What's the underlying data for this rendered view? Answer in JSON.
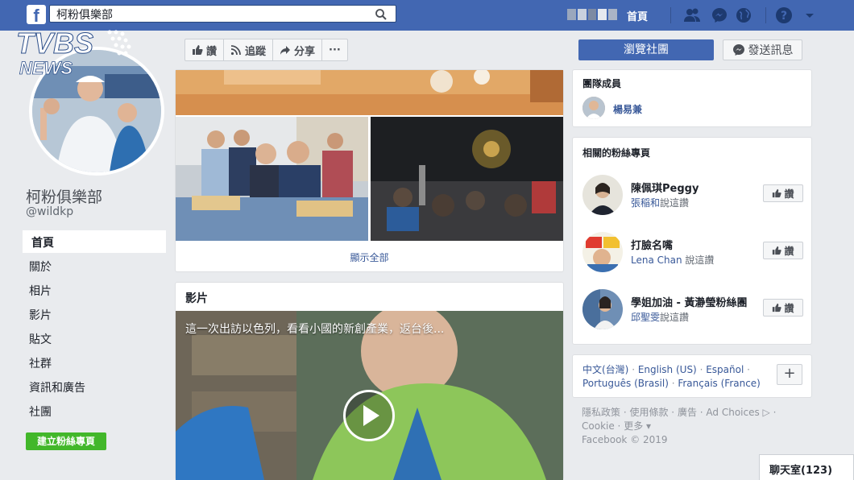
{
  "topbar": {
    "search_value": "柯粉俱樂部",
    "home_label": "首頁"
  },
  "watermark": {
    "brand": "TVBS NEWS"
  },
  "page": {
    "name": "柯粉俱樂部",
    "handle": "@wildkp"
  },
  "left_nav": {
    "items": [
      "首頁",
      "關於",
      "相片",
      "影片",
      "貼文",
      "社群",
      "資訊和廣告",
      "社團"
    ],
    "create_label": "建立粉絲專頁"
  },
  "actions": {
    "like": "讚",
    "follow": "追蹤",
    "share": "分享",
    "more": "···",
    "browse": "瀏覽社團",
    "message": "發送訊息"
  },
  "photos": {
    "show_all": "顯示全部"
  },
  "video": {
    "section_title": "影片",
    "caption": "這一次出訪以色列，看看小國的新創產業，返台後..."
  },
  "members": {
    "title": "團隊成員",
    "name": "楊易兼"
  },
  "related": {
    "title": "相關的粉絲專頁",
    "like_label": "讚",
    "items": [
      {
        "name": "陳佩琪Peggy",
        "friend": "張稲和",
        "suffix": "說這讚"
      },
      {
        "name": "打臉名嘴",
        "friend": "Lena Chan",
        "suffix": "說這讚"
      },
      {
        "name": "學姐加油 - 黃瀞瑩粉絲團",
        "friend": "邱聖雯",
        "suffix": "說這讚"
      }
    ]
  },
  "languages": {
    "line1": [
      "中文(台灣)",
      "English (US)",
      "Español"
    ],
    "line2": [
      "Português (Brasil)",
      "Français (France)"
    ],
    "add": "+"
  },
  "footer": {
    "line1": [
      "隱私政策",
      "使用條款",
      "廣告",
      "Ad Choices ▷"
    ],
    "line2": [
      "Cookie",
      "更多 ▾"
    ],
    "copyright": "Facebook © 2019"
  },
  "chat": {
    "label": "聊天室(123)"
  },
  "colors": {
    "fb_blue": "#4267b2",
    "link": "#385898",
    "green": "#42b72a"
  }
}
